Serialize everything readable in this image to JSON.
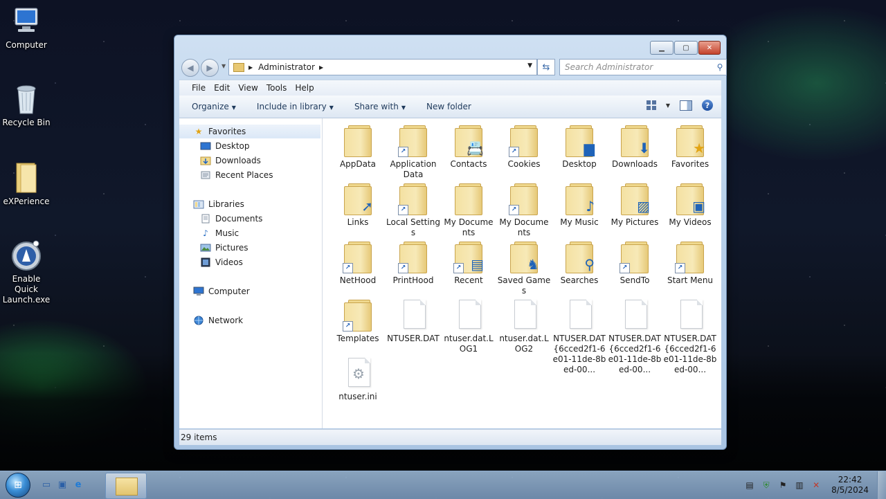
{
  "desktop": {
    "icons": [
      {
        "label": "Computer",
        "icon": "computer-icon"
      },
      {
        "label": "Recycle Bin",
        "icon": "recycle-bin-icon"
      },
      {
        "label": "eXPerience",
        "icon": "folder-icon"
      },
      {
        "label": "Enable Quick Launch.exe",
        "icon": "app-icon"
      }
    ]
  },
  "window": {
    "address": {
      "path": "Administrator"
    },
    "search": {
      "placeholder": "Search Administrator"
    },
    "menu": [
      "File",
      "Edit",
      "View",
      "Tools",
      "Help"
    ],
    "commands": {
      "organize": "Organize",
      "include": "Include in library",
      "share": "Share with",
      "new_folder": "New folder"
    },
    "nav": {
      "favorites": "Favorites",
      "desktop": "Desktop",
      "downloads": "Downloads",
      "recent_places": "Recent Places",
      "libraries": "Libraries",
      "documents": "Documents",
      "music": "Music",
      "pictures": "Pictures",
      "videos": "Videos",
      "computer": "Computer",
      "network": "Network"
    },
    "items": [
      {
        "label": "AppData",
        "type": "folder"
      },
      {
        "label": "Application Data",
        "type": "folder-shortcut"
      },
      {
        "label": "Contacts",
        "type": "folder"
      },
      {
        "label": "Cookies",
        "type": "folder-shortcut"
      },
      {
        "label": "Desktop",
        "type": "folder"
      },
      {
        "label": "Downloads",
        "type": "folder"
      },
      {
        "label": "Favorites",
        "type": "folder"
      },
      {
        "label": "Links",
        "type": "folder"
      },
      {
        "label": "Local Settings",
        "type": "folder-shortcut"
      },
      {
        "label": "My Documents",
        "type": "folder"
      },
      {
        "label": "My Documents",
        "type": "folder-shortcut"
      },
      {
        "label": "My Music",
        "type": "folder"
      },
      {
        "label": "My Pictures",
        "type": "folder"
      },
      {
        "label": "My Videos",
        "type": "folder"
      },
      {
        "label": "NetHood",
        "type": "folder-shortcut"
      },
      {
        "label": "PrintHood",
        "type": "folder-shortcut"
      },
      {
        "label": "Recent",
        "type": "folder-shortcut"
      },
      {
        "label": "Saved Games",
        "type": "folder"
      },
      {
        "label": "Searches",
        "type": "folder"
      },
      {
        "label": "SendTo",
        "type": "folder-shortcut"
      },
      {
        "label": "Start Menu",
        "type": "folder-shortcut"
      },
      {
        "label": "Templates",
        "type": "folder-shortcut"
      },
      {
        "label": "NTUSER.DAT",
        "type": "file"
      },
      {
        "label": "ntuser.dat.LOG1",
        "type": "file"
      },
      {
        "label": "ntuser.dat.LOG2",
        "type": "file"
      },
      {
        "label": "NTUSER.DAT{6cced2f1-6e01-11de-8bed-00...",
        "type": "file"
      },
      {
        "label": "NTUSER.DAT{6cced2f1-6e01-11de-8bed-00...",
        "type": "file"
      },
      {
        "label": "NTUSER.DAT{6cced2f1-6e01-11de-8bed-00...",
        "type": "file"
      },
      {
        "label": "ntuser.ini",
        "type": "settings-file"
      }
    ],
    "status": "29 items"
  },
  "taskbar": {
    "clock_time": "22:42",
    "clock_date": "8/5/2024"
  }
}
